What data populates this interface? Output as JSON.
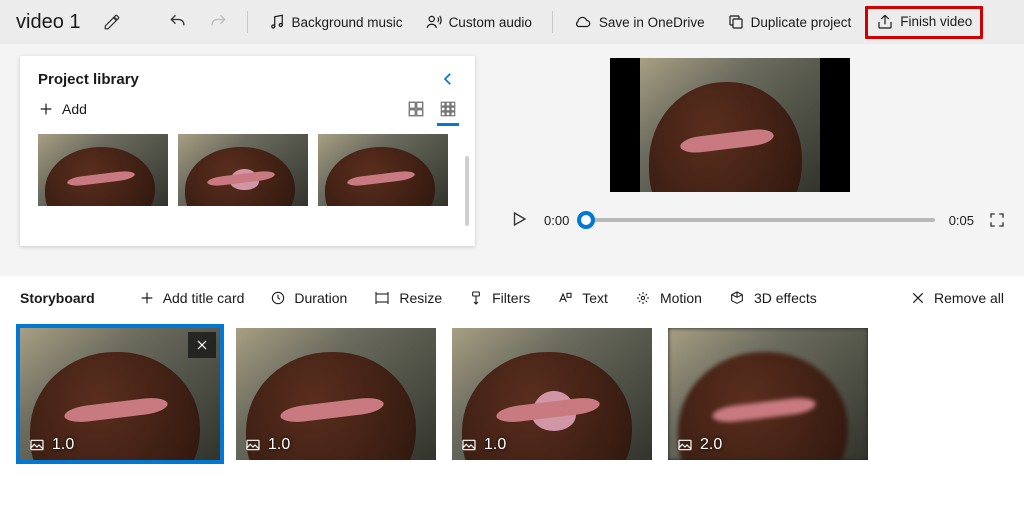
{
  "project": {
    "title": "video 1"
  },
  "topbar": {
    "bg_music": "Background music",
    "custom_audio": "Custom audio",
    "save_onedrive": "Save in OneDrive",
    "duplicate": "Duplicate project",
    "finish": "Finish video"
  },
  "library": {
    "title": "Project library",
    "add_label": "Add"
  },
  "preview": {
    "current_time": "0:00",
    "total_time": "0:05"
  },
  "storyboard": {
    "title": "Storyboard",
    "add_title_card": "Add title card",
    "duration": "Duration",
    "resize": "Resize",
    "filters": "Filters",
    "text": "Text",
    "motion": "Motion",
    "effects3d": "3D effects",
    "remove_all": "Remove all",
    "clips": [
      {
        "duration": "1.0",
        "selected": true
      },
      {
        "duration": "1.0",
        "selected": false
      },
      {
        "duration": "1.0",
        "selected": false
      },
      {
        "duration": "2.0",
        "selected": false
      }
    ]
  }
}
